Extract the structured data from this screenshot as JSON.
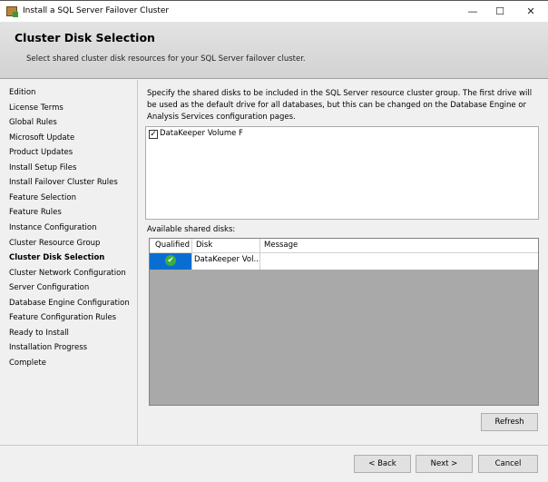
{
  "window": {
    "title": "Install a SQL Server Failover Cluster",
    "minimize": "—",
    "maximize": "☐",
    "close": "✕"
  },
  "header": {
    "title": "Cluster Disk Selection",
    "subtitle": "Select shared cluster disk resources for your SQL Server failover cluster."
  },
  "nav": {
    "items": [
      "Edition",
      "License Terms",
      "Global Rules",
      "Microsoft Update",
      "Product Updates",
      "Install Setup Files",
      "Install Failover Cluster Rules",
      "Feature Selection",
      "Feature Rules",
      "Instance Configuration",
      "Cluster Resource Group",
      "Cluster Disk Selection",
      "Cluster Network Configuration",
      "Server Configuration",
      "Database Engine Configuration",
      "Feature Configuration Rules",
      "Ready to Install",
      "Installation Progress",
      "Complete"
    ],
    "current_index": 11
  },
  "main": {
    "description": "Specify the shared disks to be included in the SQL Server resource cluster group. The first drive will be used as the default drive for all databases, but this can be changed on the Database Engine or Analysis Services configuration pages.",
    "disk_list": [
      {
        "label": "DataKeeper Volume F",
        "checked": true
      }
    ],
    "available_label": "Available shared disks:",
    "grid": {
      "columns": [
        "Qualified",
        "Disk",
        "Message"
      ],
      "rows": [
        {
          "qualified": "check-icon",
          "disk": "DataKeeper Vol...",
          "message": ""
        }
      ]
    },
    "refresh": "Refresh"
  },
  "footer": {
    "back": "< Back",
    "next": "Next >",
    "cancel": "Cancel"
  }
}
